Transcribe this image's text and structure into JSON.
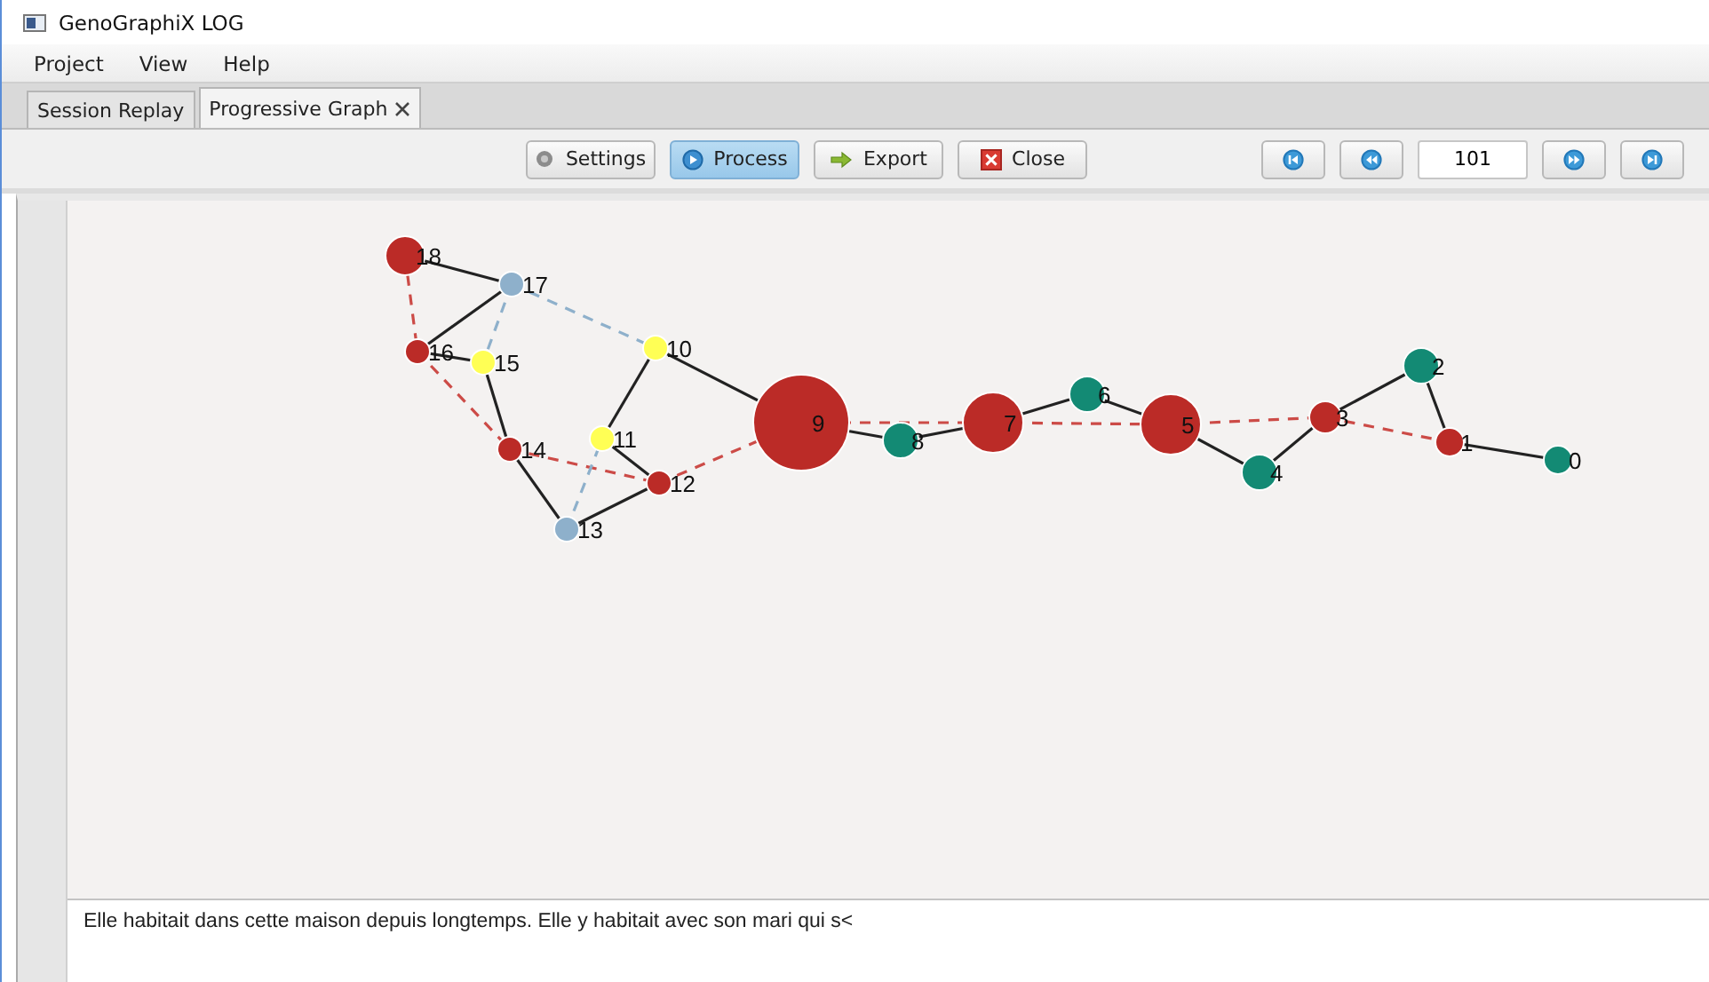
{
  "window": {
    "title": "GenoGraphiX LOG"
  },
  "menu": [
    "Project",
    "View",
    "Help"
  ],
  "tabs": [
    {
      "label": "Session Replay",
      "selected": false
    },
    {
      "label": "Progressive Graph",
      "selected": true
    }
  ],
  "toolbar": {
    "buttons": [
      {
        "label": "Settings",
        "kind": "settings",
        "pressed": false
      },
      {
        "label": "Process",
        "kind": "process",
        "pressed": true
      },
      {
        "label": "Export",
        "kind": "export",
        "pressed": false
      },
      {
        "label": "Close",
        "kind": "close",
        "pressed": false
      }
    ],
    "navigation": [
      {
        "kind": "first"
      },
      {
        "kind": "back"
      },
      {
        "kind": "field",
        "value": "101"
      },
      {
        "kind": "forward"
      },
      {
        "kind": "last"
      }
    ]
  },
  "graph": {
    "nodes": [
      {
        "label": "0",
        "color": "#138a74"
      },
      {
        "label": "1",
        "color": "#bb2b27"
      },
      {
        "label": "2",
        "color": "#138a74"
      },
      {
        "label": "3",
        "color": "#bb2b27"
      },
      {
        "label": "4",
        "color": "#138a74"
      },
      {
        "label": "5",
        "color": "#bb2b27"
      },
      {
        "label": "6",
        "color": "#138a74"
      },
      {
        "label": "7",
        "color": "#bb2b27"
      },
      {
        "label": "8",
        "color": "#138a74"
      },
      {
        "label": "9",
        "color": "#bb2b27"
      },
      {
        "label": "10",
        "color": "#ffff55"
      },
      {
        "label": "11",
        "color": "#ffff55"
      },
      {
        "label": "12",
        "color": "#bb2b27"
      },
      {
        "label": "13",
        "color": "#8eb0cb"
      },
      {
        "label": "14",
        "color": "#bb2b27"
      },
      {
        "label": "15",
        "color": "#ffff55"
      },
      {
        "label": "16",
        "color": "#bb2b27"
      },
      {
        "label": "17",
        "color": "#8eb0cb"
      },
      {
        "label": "18",
        "color": "#bb2b27"
      }
    ]
  },
  "editor": {
    "value": "Elle habitait dans cette maison depuis longtemps. Elle y habitait avec son mari qui s<"
  }
}
